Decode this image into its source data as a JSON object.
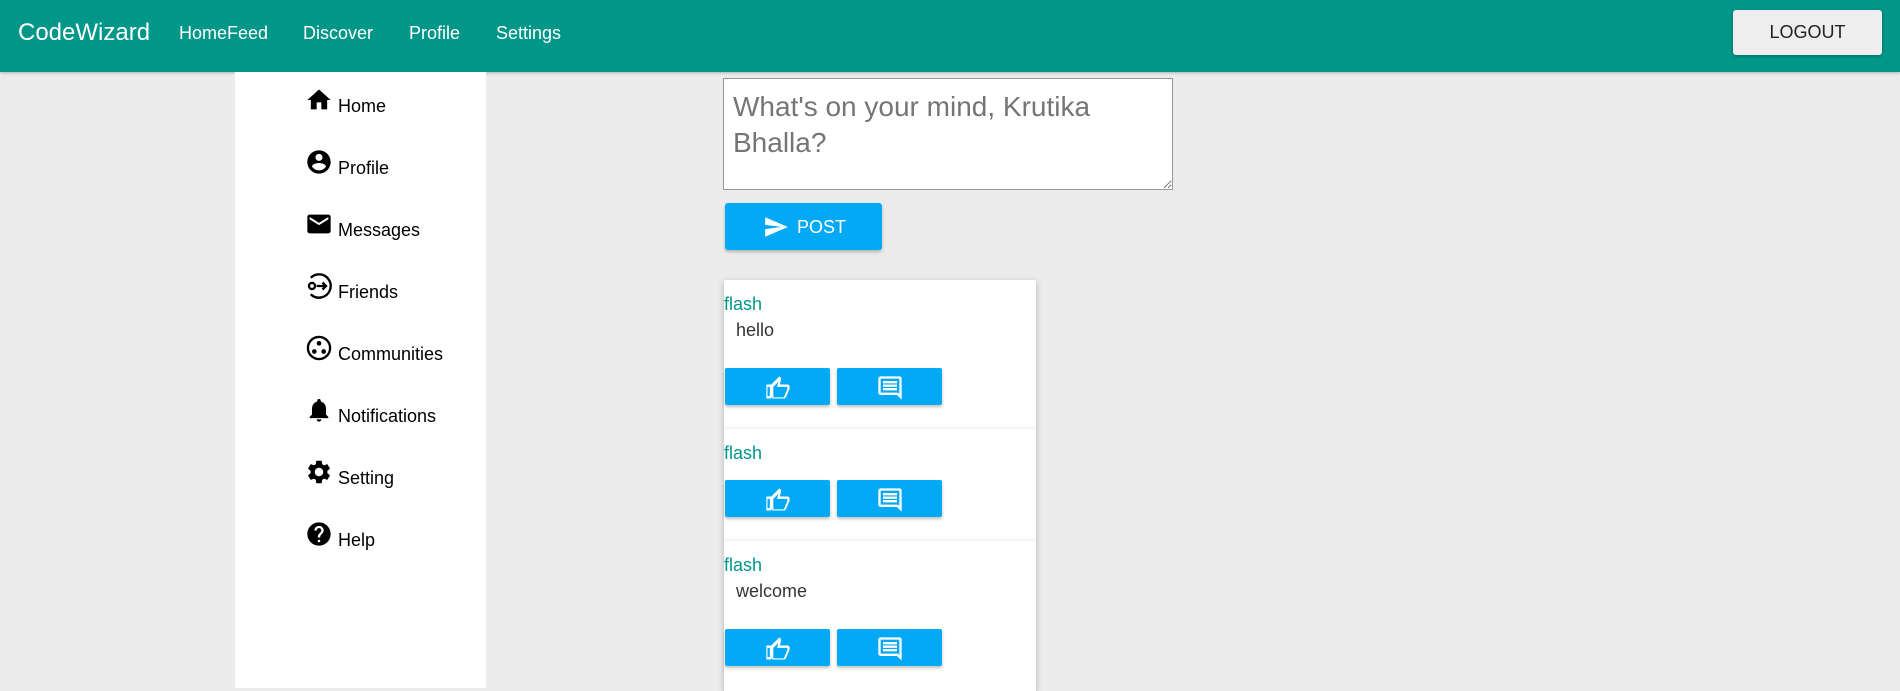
{
  "app": {
    "brand": "CodeWizard"
  },
  "nav": {
    "links": [
      "HomeFeed",
      "Discover",
      "Profile",
      "Settings"
    ],
    "logout_label": "LOGOUT"
  },
  "sidebar": {
    "items": [
      {
        "label": "Home",
        "icon": "home-icon"
      },
      {
        "label": "Profile",
        "icon": "account-circle-icon"
      },
      {
        "label": "Messages",
        "icon": "mail-icon"
      },
      {
        "label": "Friends",
        "icon": "friends-icon"
      },
      {
        "label": "Communities",
        "icon": "communities-icon"
      },
      {
        "label": "Notifications",
        "icon": "bell-icon"
      },
      {
        "label": "Setting",
        "icon": "gear-icon"
      },
      {
        "label": "Help",
        "icon": "help-icon"
      }
    ]
  },
  "composer": {
    "placeholder": "What's on your mind, Krutika Bhalla?",
    "value": "",
    "post_label": "POST"
  },
  "posts": [
    {
      "author": "flash",
      "text": "hello"
    },
    {
      "author": "flash",
      "text": ""
    },
    {
      "author": "flash",
      "text": "welcome"
    }
  ],
  "colors": {
    "accent": "#009688",
    "button": "#03a9f4",
    "background": "#ececec"
  }
}
